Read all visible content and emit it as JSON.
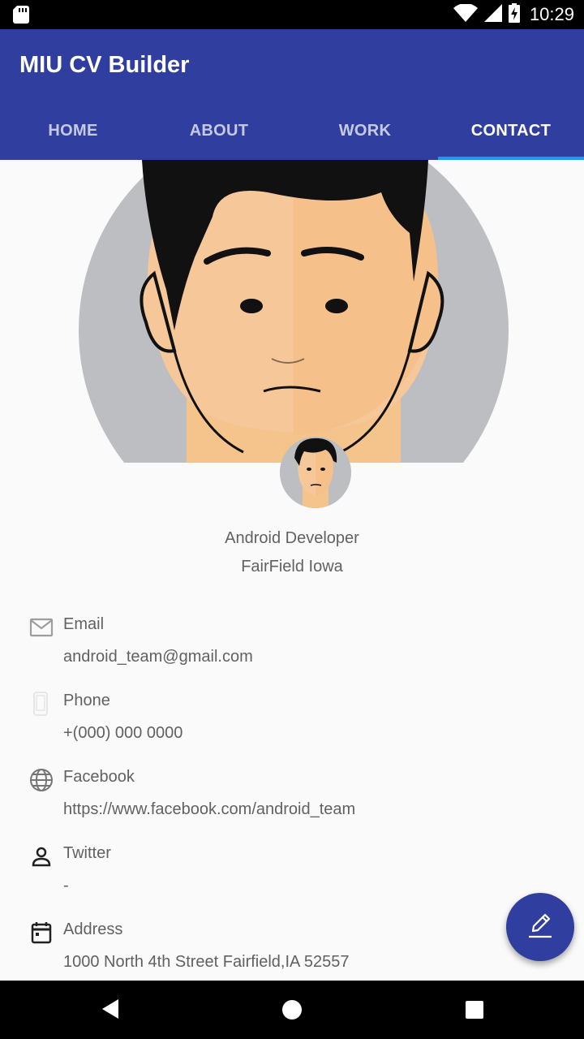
{
  "status_bar": {
    "time": "10:29"
  },
  "app_bar": {
    "title": "MIU CV Builder",
    "tabs": [
      {
        "label": "HOME",
        "active": false
      },
      {
        "label": "ABOUT",
        "active": false
      },
      {
        "label": "WORK",
        "active": false
      },
      {
        "label": "CONTACT",
        "active": true
      }
    ]
  },
  "profile": {
    "role": "Android Developer",
    "location": "FairField Iowa"
  },
  "contacts": [
    {
      "icon": "email-icon",
      "label": "Email",
      "value": "android_team@gmail.com"
    },
    {
      "icon": "phone-icon",
      "label": "Phone",
      "value": "+(000) 000 0000"
    },
    {
      "icon": "globe-icon",
      "label": "Facebook",
      "value": "https://www.facebook.com/android_team"
    },
    {
      "icon": "person-icon",
      "label": "Twitter",
      "value": "-"
    },
    {
      "icon": "calendar-icon",
      "label": "Address",
      "value": "1000 North 4th Street Fairfield,IA 52557"
    }
  ],
  "fab": {
    "icon": "edit-pencil-icon"
  },
  "colors": {
    "primary": "#303f9f",
    "tab_indicator": "#2196f3",
    "text": "#616161"
  }
}
